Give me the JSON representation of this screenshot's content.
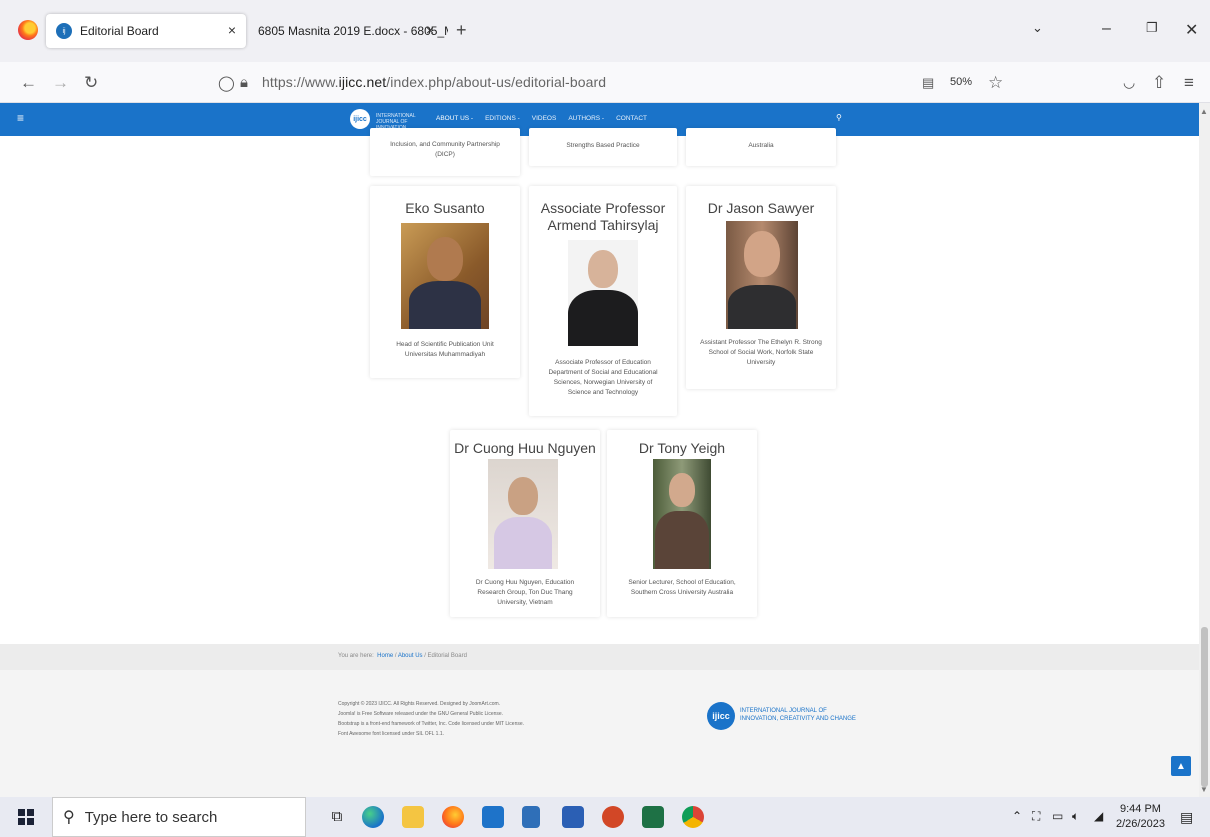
{
  "browser": {
    "tabs": [
      {
        "title": "Editorial Board",
        "close": "×",
        "active": true
      },
      {
        "title": "6805 Masnita 2019 E.docx - 6805_M...",
        "close": "×",
        "active": false
      }
    ],
    "new_tab": "+",
    "url_prefix": "https://www.",
    "url_domain": "ijicc.net",
    "url_path": "/index.php/about-us/editorial-board",
    "zoom": "50%",
    "icons": [
      "firefox-icon",
      "back-icon",
      "forward-icon",
      "reload-icon",
      "shield-icon",
      "lock-icon",
      "reader-icon",
      "star-icon",
      "pocket-icon",
      "extensions-icon",
      "menu-icon"
    ]
  },
  "site": {
    "logo": "ijicc",
    "logo_text": "INTERNATIONAL JOURNAL OF INNOVATION, CREATIVITY AND CHANGE",
    "menu": [
      "ABOUT US -",
      "EDITIONS -",
      "VIDEOS",
      "AUTHORS -",
      "CONTACT"
    ],
    "colors": {
      "header": "#1a73c9",
      "footer": "#f4f4f4"
    }
  },
  "top_cards": [
    {
      "desc": "Inclusion, and Community Partnership (DICP)"
    },
    {
      "desc": "Strengths Based Practice"
    },
    {
      "desc": "Australia"
    }
  ],
  "members": [
    {
      "name": "Eko Susanto",
      "desc": "Head of Scientific Publication Unit Universitas Muhammadiyah"
    },
    {
      "name": "Associate Professor Armend Tahirsylaj",
      "desc": "Associate Professor of Education Department of Social and Educational Sciences, Norwegian University of Science and Technology"
    },
    {
      "name": "Dr Jason Sawyer",
      "desc": "Assistant Professor The Ethelyn R. Strong School of Social Work, Norfolk State University"
    },
    {
      "name": "Dr Cuong Huu Nguyen",
      "desc": "Dr Cuong Huu Nguyen, Education Research Group, Ton Duc Thang University, Vietnam"
    },
    {
      "name": "Dr Tony Yeigh",
      "desc": "Senior Lecturer, School of Education, Southern Cross University Australia"
    }
  ],
  "breadcrumb": {
    "prefix": "You are here:",
    "items": [
      "Home",
      "About Us",
      "Editorial Board"
    ]
  },
  "footer": {
    "line1": "Copyright © 2023 IJICC. All Rights Reserved. Designed by JoomArt.com.",
    "line2": "Joomla! is Free Software released under the GNU General Public License.",
    "line3": "Bootstrap is a front-end framework of Twitter, Inc. Code licensed under MIT License.",
    "line4": "Font Awesome font licensed under SIL OFL 1.1.",
    "logo": "ijicc",
    "logo_text_1": "INTERNATIONAL JOURNAL OF",
    "logo_text_2": "INNOVATION, CREATIVITY AND CHANGE",
    "back_to_top": "▲"
  },
  "taskbar": {
    "search_placeholder": "Type here to search",
    "time": "9:44 PM",
    "date": "2/26/2023",
    "apps": [
      "task-view",
      "edge",
      "file-explorer",
      "firefox",
      "mail",
      "calculator",
      "word",
      "powerpoint",
      "excel",
      "chrome"
    ]
  }
}
